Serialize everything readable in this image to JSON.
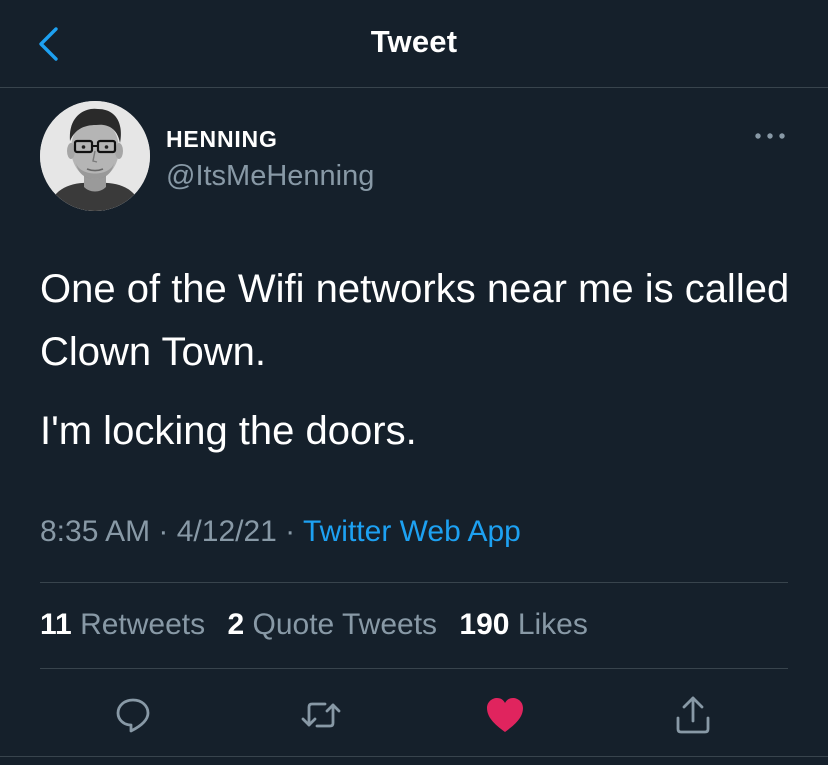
{
  "header": {
    "title": "Tweet",
    "back_icon": "chevron-left-icon"
  },
  "author": {
    "display_name": "HENNING",
    "handle": "@ItsMeHenning",
    "avatar": "avatar-photo"
  },
  "tweet": {
    "paragraphs": [
      "One of the Wifi networks near me is called Clown Town.",
      "I'm locking the doors."
    ],
    "time": "8:35 AM",
    "date": "4/12/21",
    "separator": " · ",
    "source": "Twitter Web App"
  },
  "stats": {
    "retweets": {
      "count": "11",
      "label": "Retweets"
    },
    "quote_tweets": {
      "count": "2",
      "label": "Quote Tweets"
    },
    "likes": {
      "count": "190",
      "label": "Likes"
    }
  },
  "actions": {
    "reply_icon": "reply-icon",
    "retweet_icon": "retweet-icon",
    "like_icon": "heart-icon",
    "share_icon": "share-icon"
  },
  "colors": {
    "background": "#15202b",
    "accent": "#1da1f2",
    "secondary_text": "#8899a6",
    "like": "#e0245e",
    "divider": "#38444d"
  }
}
